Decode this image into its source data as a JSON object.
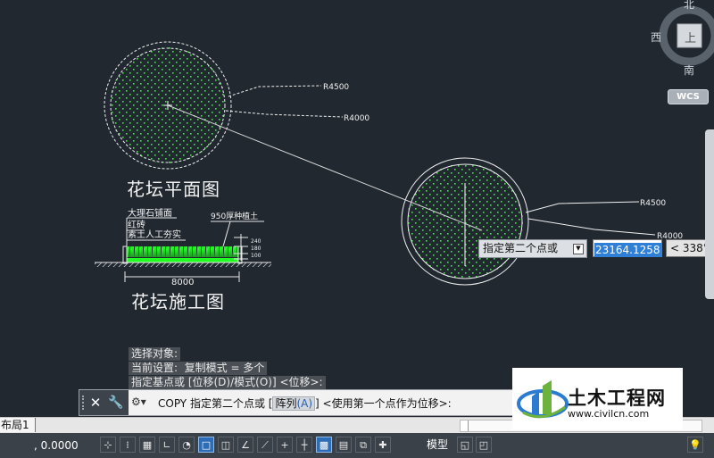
{
  "drawing": {
    "plan_title": "花坛平面图",
    "construction_title": "花坛施工图",
    "radius_outer": "R4500",
    "radius_inner": "R4000",
    "layer1": "大理石铺面",
    "layer2": "红砖",
    "layer3": "素土人工夯实",
    "soil_note": "950厚种植土",
    "dim_width": "8000",
    "dim_240": "240",
    "dim_180": "180",
    "dim_100": "100"
  },
  "history": {
    "line1": "选择对象:",
    "line2": "当前设置:  复制模式 = 多个",
    "line3": "指定基点或 [位移(D)/模式(O)] <位移>:"
  },
  "command": {
    "close_icon": "close-icon",
    "wrench_icon": "wrench-icon",
    "prefix": "COPY 指定第二个点或 [",
    "option": "阵列",
    "option_key": "(A)",
    "suffix": "] <使用第一个点作为位移>:"
  },
  "dynamic_input": {
    "prompt": "指定第二个点或",
    "value": "23164.1258",
    "angle": "< 338°"
  },
  "viewcube": {
    "north": "北",
    "west": "西",
    "south": "南",
    "face": "上",
    "wcs": "WCS"
  },
  "tabs": {
    "layout1": "布局1"
  },
  "status": {
    "coords": ", 0.0000",
    "model": "模型"
  },
  "watermark": {
    "name": "土木工程网",
    "url": "www.civilcn.com"
  },
  "colors": {
    "background": "#212830",
    "hatch": "#22ff22",
    "line": "#e8e8e8",
    "accent": "#2f7fd6"
  }
}
